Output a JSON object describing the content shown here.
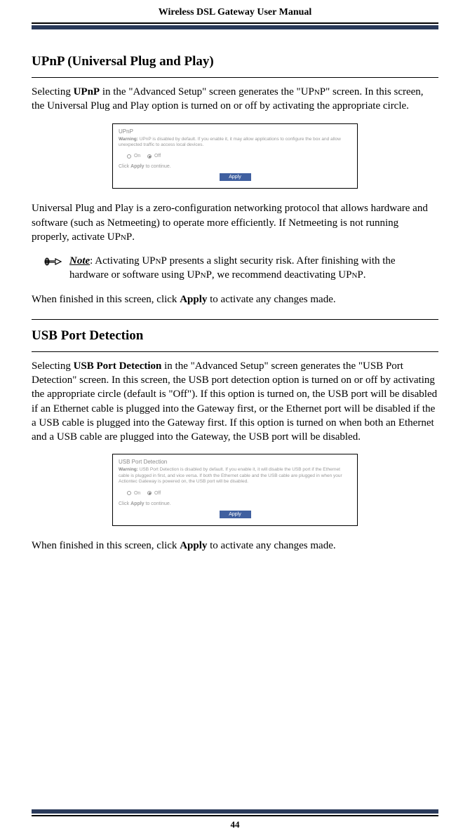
{
  "header": {
    "title": "Wireless DSL Gateway User Manual"
  },
  "upnp": {
    "title": "UPnP (Universal Plug and Play)",
    "intro_1": "Selecting ",
    "intro_bold": "UPnP",
    "intro_2": " in the \"Advanced Setup\" screen generates the \"",
    "intro_sc": "UPnP",
    "intro_3": "\" screen. In this screen, the Universal Plug and Play option is turned on or off by activating the appropriate circle.",
    "screenshot": {
      "title": "UPnP",
      "warning_label": "Warning:",
      "warning_text": " UPnP is disabled by default. If you enable it, it may allow applications to configure the box and allow unexpected traffic to access local devices.",
      "radio_on": "On",
      "radio_off": "Off",
      "apply_text_1": "Click ",
      "apply_text_bold": "Apply",
      "apply_text_2": " to continue.",
      "apply_button": "Apply"
    },
    "para2_1": "Universal Plug and Play is a zero-configuration networking protocol that allows hardware and software (such as Netmeeting) to operate more efficiently. If Netmeeting is not running properly, activate ",
    "para2_sc": "UPnP",
    "para2_2": ".",
    "note_label": "Note",
    "note_1": ": Activating ",
    "note_sc1": "UPnP",
    "note_2": " presents a slight security risk. After finishing with the hardware or software using ",
    "note_sc2": "UPnP",
    "note_3": ", we recommend deactivating ",
    "note_sc3": "UPnP",
    "note_4": ".",
    "finish_1": "When finished in this screen, click ",
    "finish_bold": "Apply",
    "finish_2": " to activate any changes made."
  },
  "usb": {
    "title": "USB Port Detection",
    "intro_1": "Selecting ",
    "intro_bold": "USB Port Detection",
    "intro_2": " in the \"Advanced Setup\" screen generates the \"",
    "intro_sc1": "USB",
    "intro_3": " Port Detection\" screen. In this screen, the ",
    "intro_sc2": "USB",
    "intro_4": " port detection option is turned on or off by activating the appropriate circle (default is \"Off\"). If this option is turned on, the ",
    "intro_sc3": "USB",
    "intro_5": " port will be disabled if an Ethernet cable is plugged into the Gateway first, or the Ethernet port will be disabled if the a ",
    "intro_sc4": "USB",
    "intro_6": " cable is plugged into the Gateway first. If this option is turned on when both an Ethernet and a ",
    "intro_sc5": "USB",
    "intro_7": " cable are plugged into the Gateway, the ",
    "intro_sc6": "USB",
    "intro_8": " port will be disabled.",
    "screenshot": {
      "title": "USB Port Detection",
      "warning_label": "Warning:",
      "warning_text": " USB Port Detection is disabled by default. If you enable it, it will disable the USB port if the Ethernet cable is plugged in first, and vice versa. If both the Ethernet cable and the USB cable are plugged in when your Actiontec Gateway is powered on, the USB port will be disabled.",
      "radio_on": "On",
      "radio_off": "Off",
      "apply_text_1": "Click ",
      "apply_text_bold": "Apply",
      "apply_text_2": " to continue.",
      "apply_button": "Apply"
    },
    "finish_1": "When finished in this screen, click ",
    "finish_bold": "Apply",
    "finish_2": " to activate any changes made."
  },
  "footer": {
    "page_number": "44"
  }
}
